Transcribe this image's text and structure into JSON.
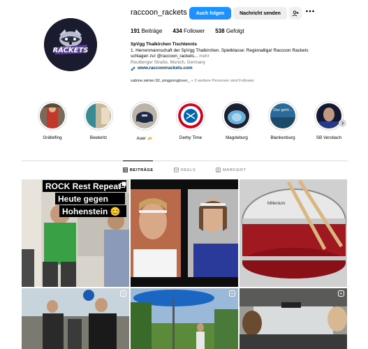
{
  "profile": {
    "username": "raccoon_rackets",
    "follow_label": "Auch folgen",
    "message_label": "Nachricht senden",
    "add_icon": "person-add-icon",
    "more_icon": "more-horizontal-icon",
    "avatar_logo_text": "RACKETS",
    "avatar_logo_subtext": "RACCOON"
  },
  "stats": {
    "posts_count": "191",
    "posts_label": "Beiträge",
    "followers_count": "434",
    "followers_label": "Follower",
    "following_count": "538",
    "following_label": "Gefolgt"
  },
  "bio": {
    "name": "SpVgg Thalkirchen Tischtennis",
    "line1": "1. Herrenmannschaft der SpVgg Thalkirchen. Spielklasse: Regionalliga! Raccoon Rackets",
    "line2": "schlagen zu! @raccoon_rackets... ",
    "more": "mehr",
    "location": "Reutberger Straße, Munich, Germany",
    "link": "www.raccoonrackets.com",
    "followed_by_names": "sabine.winter.92, pingponglover_",
    "followed_by_rest": " + 3 weitere Personen sind Follower"
  },
  "highlights": [
    {
      "label": "Gräfelfing"
    },
    {
      "label": "Biederitz"
    },
    {
      "label": "Auer 🍻"
    },
    {
      "label": "Derby Time"
    },
    {
      "label": "Magdeburg"
    },
    {
      "label": "Blankenburg"
    },
    {
      "label": "SB Versbach"
    }
  ],
  "highlight_badge": {
    "bayern_text": "FC BAYERN MÜNCHEN",
    "story_caption": "Das geht..."
  },
  "tabs": {
    "posts": "BEITRÄGE",
    "reels": "REELS",
    "tagged": "MARKIERT"
  },
  "posts": {
    "caption_line1": "ROCK Rest Repeat",
    "caption_line2": "Heute gegen",
    "caption_line3": "Hohenstein 😊",
    "drum_brand": "Millenium"
  },
  "colors": {
    "accent_blue": "#1e90ff",
    "link_blue": "#00376b",
    "secondary_text": "#737373",
    "divider": "#dbdbdb"
  }
}
